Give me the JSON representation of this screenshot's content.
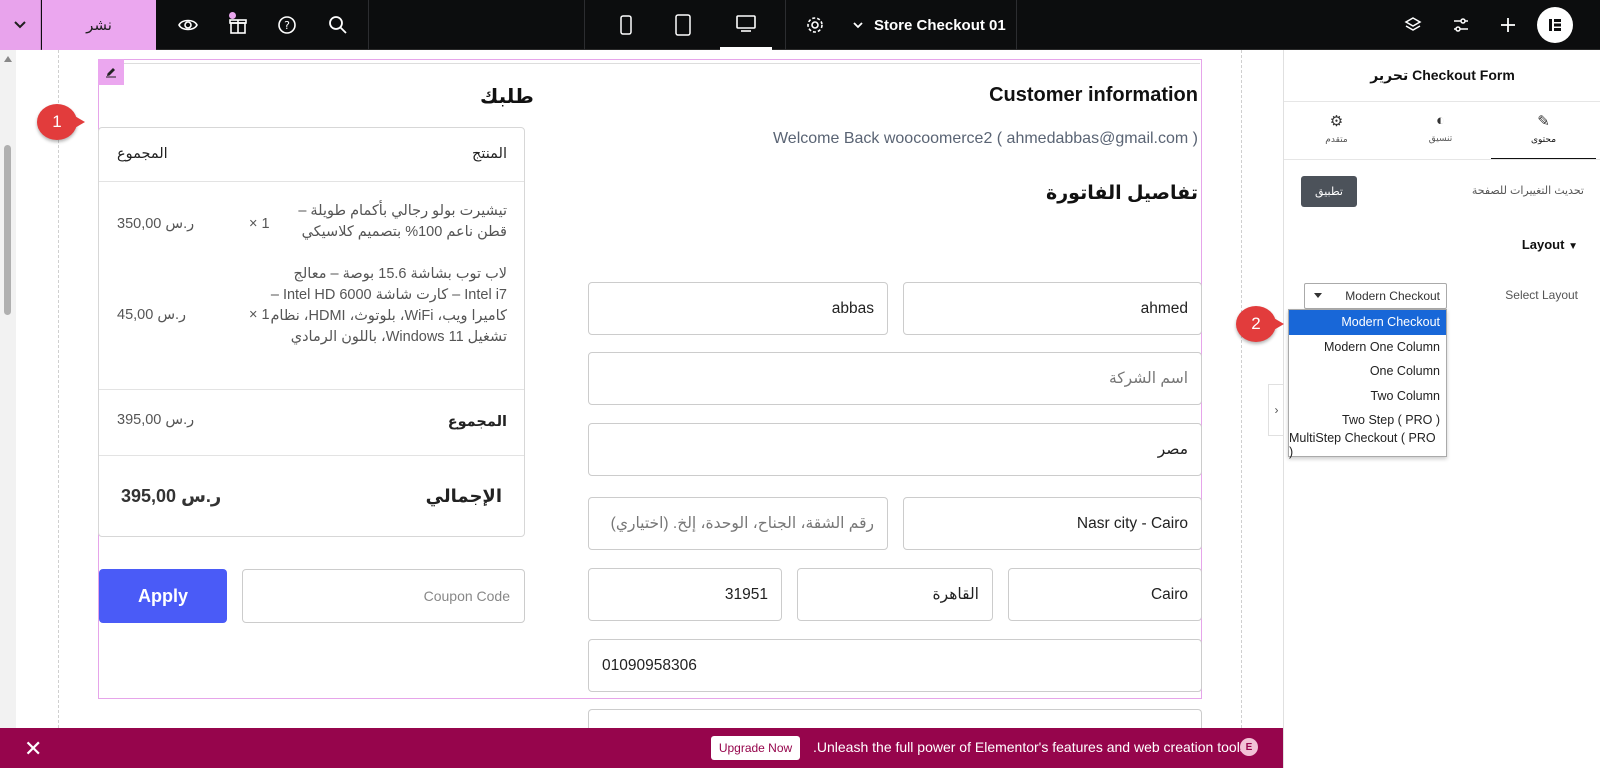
{
  "topbar": {
    "publish_label": "نشر",
    "page_title": "Store Checkout 01",
    "icons": [
      "chevron-down-icon",
      "eye-icon",
      "gift-icon",
      "help-icon",
      "search-icon",
      "mobile-icon",
      "tablet-icon",
      "desktop-icon",
      "settings-icon",
      "layers-icon",
      "sliders-icon",
      "plus-icon",
      "elementor-logo-icon"
    ]
  },
  "markers": {
    "one": "1",
    "two": "2"
  },
  "order": {
    "title": "طلبك",
    "col_product": "المنتج",
    "col_total": "المجموع",
    "items": [
      {
        "name": "تيشيرت بولو رجالي بأكمام طويلة – قطن ناعم 100% بتصميم كلاسيكي",
        "qty": "× 1",
        "price": "350,00 ر.س"
      },
      {
        "name": "لاب توب بشاشة 15.6 بوصة – معالج Intel i7 – كارت شاشة Intel HD 6000 – كاميرا ويب، WiFi، بلوتوث، HDMI، نظام تشغيل Windows 11، باللون الرمادي",
        "qty": "× 1",
        "price": "45,00 ر.س"
      }
    ],
    "subtotal_label": "المجموع",
    "subtotal_value": "395,00 ر.س",
    "total_label": "الإجمالي",
    "total_value": "395,00 ر.س",
    "apply_label": "Apply",
    "coupon_placeholder": "Coupon Code"
  },
  "customer": {
    "title": "Customer information",
    "welcome": "Welcome Back woocoomerce2 ( ahmedabbas@gmail.com )",
    "billing_title": "تفاصيل الفاتورة",
    "first_name": "ahmed",
    "last_name": "abbas",
    "company_placeholder": "اسم الشركة",
    "country": "مصر",
    "address": "Nasr city - Cairo",
    "address2_placeholder": "رقم الشقة، الجناح، الوحدة، إلخ. (اختياري)",
    "city": "Cairo",
    "state": "القاهرة",
    "postcode": "31951",
    "phone": "01090958306"
  },
  "panel": {
    "header": "تحرير Checkout Form",
    "tabs": [
      {
        "label": "محتوى",
        "icon": "pencil-icon"
      },
      {
        "label": "تنسيق",
        "icon": "contrast-icon"
      },
      {
        "label": "متقدم",
        "icon": "gear-icon"
      }
    ],
    "update_label": "تحديث التغييرات للصفحة",
    "apply_small": "تطبيق",
    "layout_heading": "Layout",
    "select_layout_label": "Select Layout",
    "select_value": "Modern Checkout",
    "options": [
      "Modern Checkout",
      "Modern One Column",
      "One Column",
      "Two Column",
      "Two Step ( PRO )",
      "MultiStep Checkout ( PRO )"
    ]
  },
  "promo": {
    "close": "✕",
    "upgrade_label": "Upgrade Now",
    "text": ".Unleash the full power of Elementor's features and web creation tools"
  },
  "colors": {
    "accent": "#eba7ef",
    "apply_blue": "#4a5bf7",
    "promo_bg": "#96054c",
    "dropdown_selected": "#1867d8"
  }
}
